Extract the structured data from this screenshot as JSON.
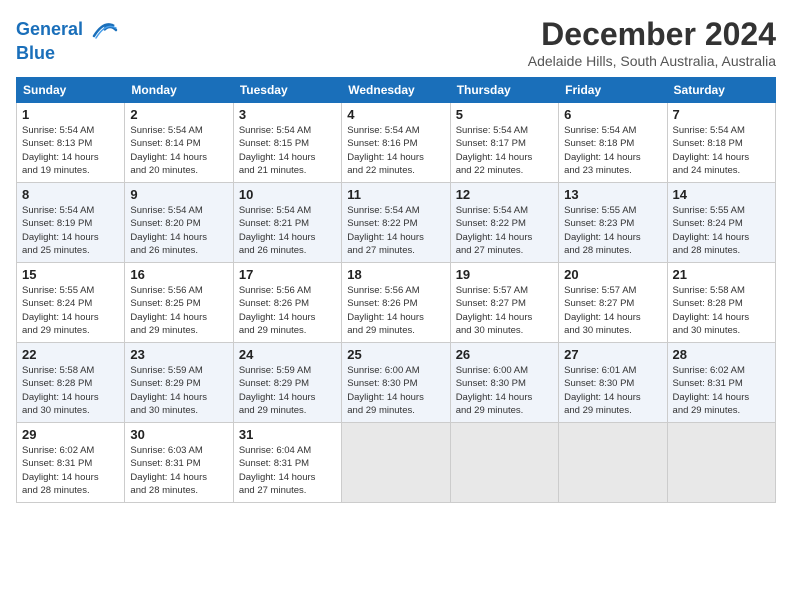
{
  "logo": {
    "line1": "General",
    "line2": "Blue"
  },
  "title": "December 2024",
  "location": "Adelaide Hills, South Australia, Australia",
  "days_of_week": [
    "Sunday",
    "Monday",
    "Tuesday",
    "Wednesday",
    "Thursday",
    "Friday",
    "Saturday"
  ],
  "weeks": [
    [
      {
        "day": "1",
        "sunrise": "5:54 AM",
        "sunset": "8:13 PM",
        "daylight": "14 hours and 19 minutes."
      },
      {
        "day": "2",
        "sunrise": "5:54 AM",
        "sunset": "8:14 PM",
        "daylight": "14 hours and 20 minutes."
      },
      {
        "day": "3",
        "sunrise": "5:54 AM",
        "sunset": "8:15 PM",
        "daylight": "14 hours and 21 minutes."
      },
      {
        "day": "4",
        "sunrise": "5:54 AM",
        "sunset": "8:16 PM",
        "daylight": "14 hours and 22 minutes."
      },
      {
        "day": "5",
        "sunrise": "5:54 AM",
        "sunset": "8:17 PM",
        "daylight": "14 hours and 22 minutes."
      },
      {
        "day": "6",
        "sunrise": "5:54 AM",
        "sunset": "8:18 PM",
        "daylight": "14 hours and 23 minutes."
      },
      {
        "day": "7",
        "sunrise": "5:54 AM",
        "sunset": "8:18 PM",
        "daylight": "14 hours and 24 minutes."
      }
    ],
    [
      {
        "day": "8",
        "sunrise": "5:54 AM",
        "sunset": "8:19 PM",
        "daylight": "14 hours and 25 minutes."
      },
      {
        "day": "9",
        "sunrise": "5:54 AM",
        "sunset": "8:20 PM",
        "daylight": "14 hours and 26 minutes."
      },
      {
        "day": "10",
        "sunrise": "5:54 AM",
        "sunset": "8:21 PM",
        "daylight": "14 hours and 26 minutes."
      },
      {
        "day": "11",
        "sunrise": "5:54 AM",
        "sunset": "8:22 PM",
        "daylight": "14 hours and 27 minutes."
      },
      {
        "day": "12",
        "sunrise": "5:54 AM",
        "sunset": "8:22 PM",
        "daylight": "14 hours and 27 minutes."
      },
      {
        "day": "13",
        "sunrise": "5:55 AM",
        "sunset": "8:23 PM",
        "daylight": "14 hours and 28 minutes."
      },
      {
        "day": "14",
        "sunrise": "5:55 AM",
        "sunset": "8:24 PM",
        "daylight": "14 hours and 28 minutes."
      }
    ],
    [
      {
        "day": "15",
        "sunrise": "5:55 AM",
        "sunset": "8:24 PM",
        "daylight": "14 hours and 29 minutes."
      },
      {
        "day": "16",
        "sunrise": "5:56 AM",
        "sunset": "8:25 PM",
        "daylight": "14 hours and 29 minutes."
      },
      {
        "day": "17",
        "sunrise": "5:56 AM",
        "sunset": "8:26 PM",
        "daylight": "14 hours and 29 minutes."
      },
      {
        "day": "18",
        "sunrise": "5:56 AM",
        "sunset": "8:26 PM",
        "daylight": "14 hours and 29 minutes."
      },
      {
        "day": "19",
        "sunrise": "5:57 AM",
        "sunset": "8:27 PM",
        "daylight": "14 hours and 30 minutes."
      },
      {
        "day": "20",
        "sunrise": "5:57 AM",
        "sunset": "8:27 PM",
        "daylight": "14 hours and 30 minutes."
      },
      {
        "day": "21",
        "sunrise": "5:58 AM",
        "sunset": "8:28 PM",
        "daylight": "14 hours and 30 minutes."
      }
    ],
    [
      {
        "day": "22",
        "sunrise": "5:58 AM",
        "sunset": "8:28 PM",
        "daylight": "14 hours and 30 minutes."
      },
      {
        "day": "23",
        "sunrise": "5:59 AM",
        "sunset": "8:29 PM",
        "daylight": "14 hours and 30 minutes."
      },
      {
        "day": "24",
        "sunrise": "5:59 AM",
        "sunset": "8:29 PM",
        "daylight": "14 hours and 29 minutes."
      },
      {
        "day": "25",
        "sunrise": "6:00 AM",
        "sunset": "8:30 PM",
        "daylight": "14 hours and 29 minutes."
      },
      {
        "day": "26",
        "sunrise": "6:00 AM",
        "sunset": "8:30 PM",
        "daylight": "14 hours and 29 minutes."
      },
      {
        "day": "27",
        "sunrise": "6:01 AM",
        "sunset": "8:30 PM",
        "daylight": "14 hours and 29 minutes."
      },
      {
        "day": "28",
        "sunrise": "6:02 AM",
        "sunset": "8:31 PM",
        "daylight": "14 hours and 29 minutes."
      }
    ],
    [
      {
        "day": "29",
        "sunrise": "6:02 AM",
        "sunset": "8:31 PM",
        "daylight": "14 hours and 28 minutes."
      },
      {
        "day": "30",
        "sunrise": "6:03 AM",
        "sunset": "8:31 PM",
        "daylight": "14 hours and 28 minutes."
      },
      {
        "day": "31",
        "sunrise": "6:04 AM",
        "sunset": "8:31 PM",
        "daylight": "14 hours and 27 minutes."
      },
      null,
      null,
      null,
      null
    ]
  ],
  "labels": {
    "sunrise": "Sunrise:",
    "sunset": "Sunset:",
    "daylight": "Daylight:"
  }
}
